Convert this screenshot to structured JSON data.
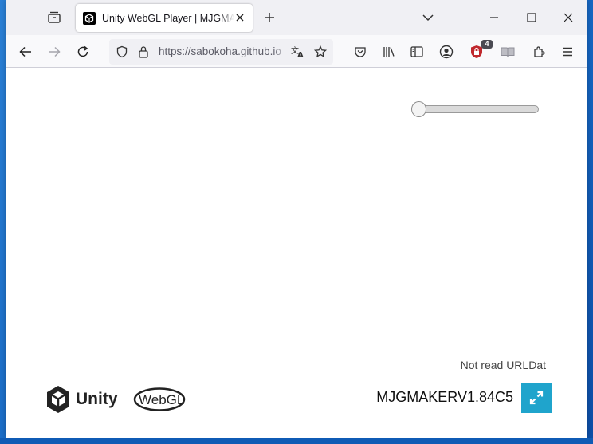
{
  "browser": {
    "tab": {
      "title": "Unity WebGL Player | MJGMAKER"
    },
    "url": "https://sabokoha.github.io",
    "extension_badge": "4"
  },
  "page": {
    "volume_slider": {
      "value": 0
    },
    "url_note": "Not read URLDat",
    "logo": {
      "unity": "Unity",
      "webgl": "WebGL"
    },
    "build_title": "MJGMAKERV1.84C5"
  },
  "colors": {
    "fullscreen_button": "#1fa4cc",
    "desktop": "#1565c0"
  },
  "icons": [
    "tab-overview-icon",
    "unity-favicon-icon",
    "close-icon",
    "plus-icon",
    "chevron-down-icon",
    "minimize-icon",
    "maximize-icon",
    "window-close-icon",
    "back-arrow-icon",
    "forward-arrow-icon",
    "reload-icon",
    "shield-icon",
    "lock-icon",
    "translate-icon",
    "star-icon",
    "pocket-icon",
    "library-icon",
    "sidebar-icon",
    "account-icon",
    "ublock-icon",
    "reader-view-icon",
    "extensions-icon",
    "menu-icon",
    "unity-logo-icon",
    "fullscreen-icon"
  ]
}
